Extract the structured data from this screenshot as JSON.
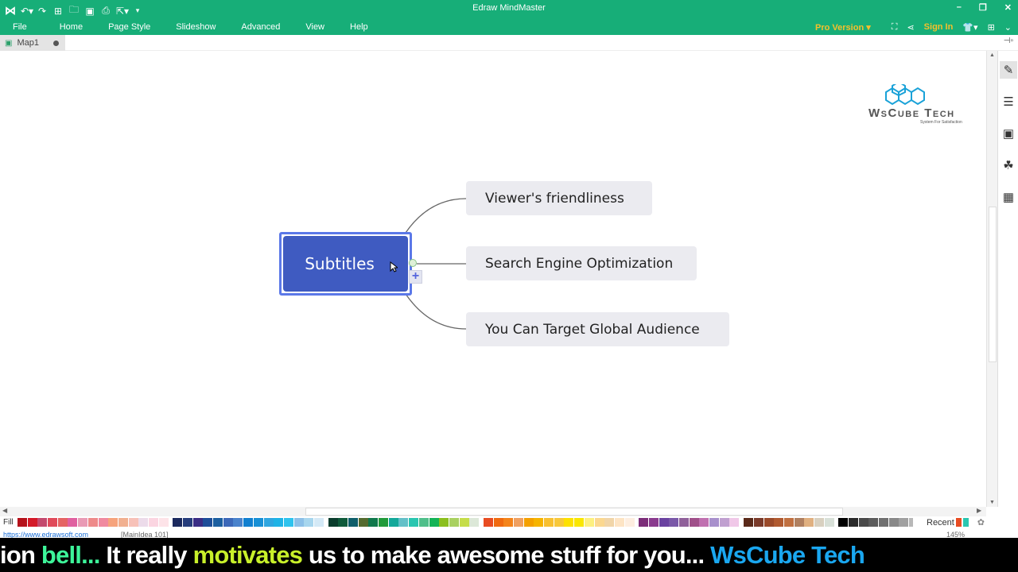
{
  "app": {
    "title": "Edraw MindMaster",
    "logo_icon": "mindmaster-logo-icon",
    "quick_access": [
      "undo-icon",
      "redo-icon",
      "new-icon",
      "open-icon",
      "save-icon",
      "print-icon",
      "export-icon",
      "customize-icon"
    ],
    "window_controls": {
      "minimize": "–",
      "restore": "❐",
      "close": "✕"
    }
  },
  "menu": {
    "items": [
      "File",
      "Home",
      "Page Style",
      "Slideshow",
      "Advanced",
      "View",
      "Help"
    ],
    "pro_version": "Pro Version ▾",
    "sign_in": "Sign In"
  },
  "tabs": [
    {
      "label": "Map1",
      "modified": true
    }
  ],
  "watermark": {
    "brand": "WsCube Tech",
    "tagline": "System For Satisfaction"
  },
  "mindmap": {
    "central": "Subtitles",
    "branches": [
      "Viewer's friendliness",
      "Search Engine Optimization",
      "You Can Target Global Audience"
    ],
    "connector_color": "#666666",
    "central_color": "#3f5bc1",
    "selection_color": "#5b78e8"
  },
  "side_panel": [
    "format-icon",
    "outline-icon",
    "mark-icon",
    "clipart-icon",
    "task-icon"
  ],
  "fill_bar": {
    "label": "Fill",
    "colors": [
      "#b5121b",
      "#d41a29",
      "#c44a6e",
      "#e04a5a",
      "#e56464",
      "#e060a0",
      "#e99ab5",
      "#ee8a8a",
      "#f08aa0",
      "#f6a37c",
      "#f1b090",
      "#f7c1b8",
      "#ecdbea",
      "#fbd5e1",
      "#fde3e8",
      "#1c2a5e",
      "#263d7c",
      "#3a2d85",
      "#1e4e99",
      "#1c5fa0",
      "#3c68b9",
      "#4a83cc",
      "#1180d0",
      "#1890d6",
      "#2fa6e0",
      "#1eb3e6",
      "#2ec3ee",
      "#8cc0e8",
      "#a7d6ee",
      "#d4e9f6",
      "#0b3d2d",
      "#0f5a3a",
      "#0f5e6a",
      "#556b2f",
      "#10784c",
      "#219a3a",
      "#14a89a",
      "#63c0c8",
      "#2ac6b0",
      "#4fbf8a",
      "#14b356",
      "#8bbf1e",
      "#a9d160",
      "#c5dd4a",
      "#dce8d8",
      "#e84c22",
      "#f06a10",
      "#f4841a",
      "#f0a060",
      "#f4a000",
      "#f6b400",
      "#f8c030",
      "#f8c83a",
      "#fde100",
      "#fae700",
      "#fdf080",
      "#fbd890",
      "#f1d5a8",
      "#fde4c4",
      "#fdeee0",
      "#7c2d79",
      "#8a3a8e",
      "#6a42a0",
      "#7a58a8",
      "#90609a",
      "#a0508a",
      "#c070b0",
      "#a890cc",
      "#c0a0d0",
      "#f0c8e8",
      "#5a2a1a",
      "#7a3a2a",
      "#9a4a2a",
      "#b05a30",
      "#c07040",
      "#b08060",
      "#e0b080",
      "#d8d0c0",
      "#d8e0d8",
      "#000000",
      "#2a2a2a",
      "#4a4a4a",
      "#5c5c5c",
      "#707070",
      "#888888",
      "#a0a0a0",
      "#b8b8b8",
      "#cccccc",
      "#e0e0e0"
    ],
    "recent_label": "Recent",
    "recent_colors": [
      "#e84c22",
      "#2ac6b0"
    ]
  },
  "status": {
    "url": "https://www.edrawsoft.com",
    "selection": "[MainIdea 101]",
    "zoom": "145%"
  },
  "caption": {
    "segments": [
      {
        "text": "ion ",
        "color": "#ffffff"
      },
      {
        "text": "bell...",
        "color": "#3df59a"
      },
      {
        "text": " It really ",
        "color": "#ffffff"
      },
      {
        "text": "motivates",
        "color": "#c8f02a"
      },
      {
        "text": " us to make awesome stuff for you... ",
        "color": "#ffffff"
      },
      {
        "text": "WsCube Tech",
        "color": "#1aa7f0"
      }
    ]
  }
}
